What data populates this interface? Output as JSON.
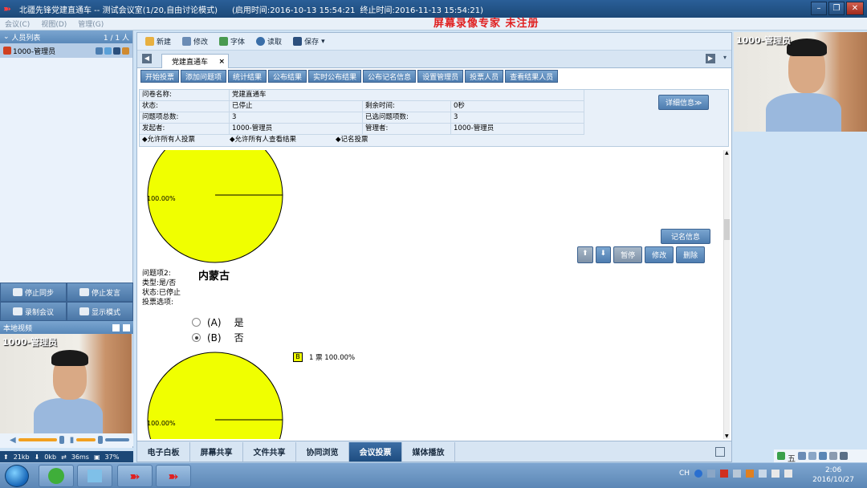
{
  "window": {
    "title": "北疆先锋党建直通车 -- 测试会议室(1/20,自由讨论模式)",
    "start_time": "(启用时间:2016-10-13 15:54:21",
    "end_time": "终止时间:2016-11-13 15:54:21)"
  },
  "menu": {
    "items": [
      "会议(C)",
      "视图(D)",
      "管理(G)"
    ],
    "banner": "屏幕录像专家 未注册"
  },
  "sidebar": {
    "header": "人员列表",
    "count": "1 / 1 人",
    "user": "1000-管理员",
    "buttons": {
      "stop_sync": "停止同步",
      "stop_speak": "停止发言",
      "record": "录制会议",
      "display_mode": "显示模式"
    },
    "local_video": "本地视频",
    "video_label": "1000-管理员",
    "status": {
      "up": "21kb",
      "down": "0kb",
      "latency": "36ms",
      "cpu": "37%"
    }
  },
  "toolbar": {
    "new": "新建",
    "edit": "修改",
    "font": "字体",
    "read": "读取",
    "save": "保存"
  },
  "tab": {
    "label": "党建直通车",
    "close": "×"
  },
  "actions": [
    "开始投票",
    "添加问题项",
    "统计结果",
    "公布结果",
    "实时公布结果",
    "公布记名信息",
    "设置管理员",
    "投票人员",
    "查看结果人员"
  ],
  "info": {
    "title_label": "问卷名称:",
    "title_value": "党建直通车",
    "status_label": "状态:",
    "status_value": "已停止",
    "remaining_label": "剩余时间:",
    "remaining_value": "0秒",
    "total_label": "问题项总数:",
    "total_value": "3",
    "selected_label": "已选问题项数:",
    "selected_value": "3",
    "initiator_label": "发起者:",
    "initiator_value": "1000-管理员",
    "manager_label": "管理者:",
    "manager_value": "1000-管理员",
    "opt1": "◆允许所有人投票",
    "opt2": "◆允许所有人查看结果",
    "opt3": "◆记名投票",
    "detail_button": "详细信息≫"
  },
  "content": {
    "pie1_label": "100.00%",
    "record_info": "记名信息",
    "btn_pause": "暂停",
    "btn_edit": "修改",
    "btn_delete": "删除",
    "q2_title": "问题项2:",
    "q2_name": "内蒙古",
    "q2_type": "类型:是/否",
    "q2_status": "状态:已停止",
    "q2_options": "投票选项:",
    "optA_key": "(A)",
    "optA_val": "是",
    "optB_key": "(B)",
    "optB_val": "否",
    "legend_key": "B",
    "legend_text": "1 票 100.00%",
    "pie2_label": "100.00%"
  },
  "bottom_tabs": [
    "电子白板",
    "屏幕共享",
    "文件共享",
    "协同浏览",
    "会议投票",
    "媒体播放"
  ],
  "right_video_label": "1000-管理员",
  "tray_ime": "五",
  "taskbar": {
    "lang": "CH",
    "time": "2:06",
    "date": "2016/10/27"
  },
  "chart_data": [
    {
      "type": "pie",
      "categories": [
        ""
      ],
      "values": [
        100
      ],
      "labels": [
        "100.00%"
      ],
      "colors": [
        "#f0ff00"
      ]
    },
    {
      "type": "pie",
      "categories": [
        "B"
      ],
      "values": [
        100
      ],
      "labels": [
        "100.00%"
      ],
      "legend": [
        "1 票 100.00%"
      ],
      "colors": [
        "#f0ff00"
      ]
    }
  ]
}
